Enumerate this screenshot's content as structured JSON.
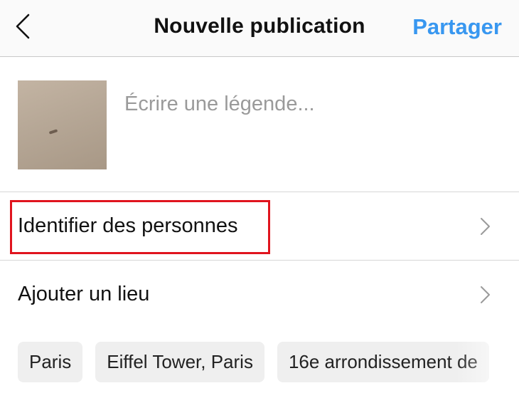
{
  "header": {
    "back_icon": "chevron-left-icon",
    "title": "Nouvelle publication",
    "share_label": "Partager",
    "accent_color": "#3897f0"
  },
  "compose": {
    "caption_placeholder": "Écrire une légende...",
    "caption_value": ""
  },
  "rows": {
    "tag_people": "Identifier des personnes",
    "add_location": "Ajouter un lieu",
    "chevron_icon": "chevron-right-icon"
  },
  "location_suggestions": [
    "Paris",
    "Eiffel Tower, Paris",
    "16e arrondissement de"
  ],
  "highlight_color": "#e0141e"
}
